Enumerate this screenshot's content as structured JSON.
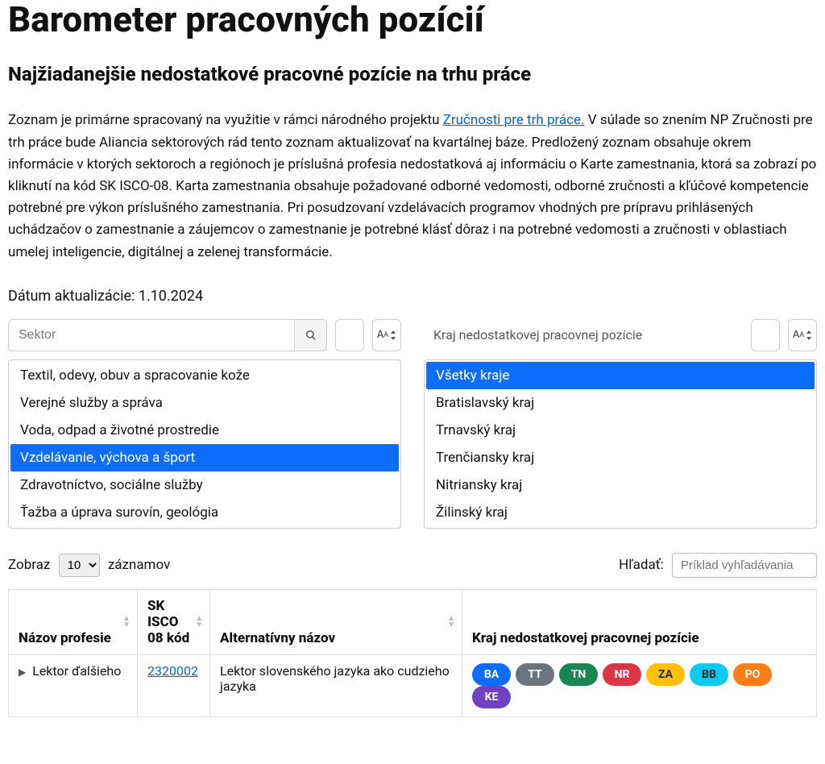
{
  "title": "Barometer pracovných pozícií",
  "subtitle": "Najžiadanejšie nedostatkové pracovné pozície na trhu práce",
  "intro_pre": "Zoznam je primárne spracovaný na využitie v rámci národného projektu ",
  "intro_link": "Zručnosti pre trh práce.",
  "intro_post": " V súlade so znením NP Zručnosti pre trh práce bude Aliancia sektorových rád tento zoznam aktualizovať na kvartálnej báze. Predložený zoznam obsahuje okrem informácie v ktorých sektoroch a regiónoch je príslušná profesia nedostatková aj informáciu o Karte zamestnania, ktorá sa zobrazí po kliknutí na kód SK ISCO-08. Karta zamestnania obsahuje požadované odborné vedomosti, odborné zručnosti a kľúčové kompetencie potrebné pre výkon príslušného zamestnania. Pri posudzovaní vzdelávacích programov vhodných pre prípravu prihlásených uchádzačov o zamestnanie a záujemcov o zamestnanie je potrebné klásť dôraz i na potrebné vedomosti a zručnosti v oblastiach umelej inteligencie, digitálnej a zelenej transformácie.",
  "date_label": "Dátum aktualizácie: ",
  "date_value": "1.10.2024",
  "sector_placeholder": "Sektor",
  "region_label": "Kraj nedostatkovej pracovnej pozície",
  "sectors": {
    "items": [
      "Textil, odevy, obuv a spracovanie kože",
      "Verejné služby a správa",
      "Voda, odpad a životné prostredie",
      "Vzdelávanie, výchova a šport",
      "Zdravotníctvo, sociálne služby",
      "Ťažba a úprava surovín, geológia"
    ],
    "selected_index": 3
  },
  "regions": {
    "items": [
      "Všetky kraje",
      "Bratislavský kraj",
      "Trnavský kraj",
      "Trenčiansky kraj",
      "Nitriansky kraj",
      "Žilinský kraj"
    ],
    "selected_index": 0
  },
  "table": {
    "show_label": "Zobraz",
    "show_value": "10",
    "records_label": "záznamov",
    "search_label": "Hľadať:",
    "search_placeholder": "Príklad vyhľadávania",
    "headers": {
      "name": "Názov profesie",
      "code": "SK ISCO 08 kód",
      "alt": "Alternatívny názov",
      "region": "Kraj nedostatkovej pracovnej pozície"
    },
    "rows": [
      {
        "name": "Lektor ďalšieho",
        "code": "2320002",
        "alt": "Lektor slovenského jazyka ako cudzieho jazyka",
        "badges": [
          "BA",
          "TT",
          "TN",
          "NR",
          "ZA",
          "BB",
          "PO",
          "KE"
        ]
      }
    ]
  },
  "badge_colors": {
    "BA": "bBA",
    "TT": "bTT",
    "TN": "bTN",
    "NR": "bNR",
    "ZA": "bZA",
    "BB": "bBB",
    "PO": "bPO",
    "KE": "bKE"
  }
}
